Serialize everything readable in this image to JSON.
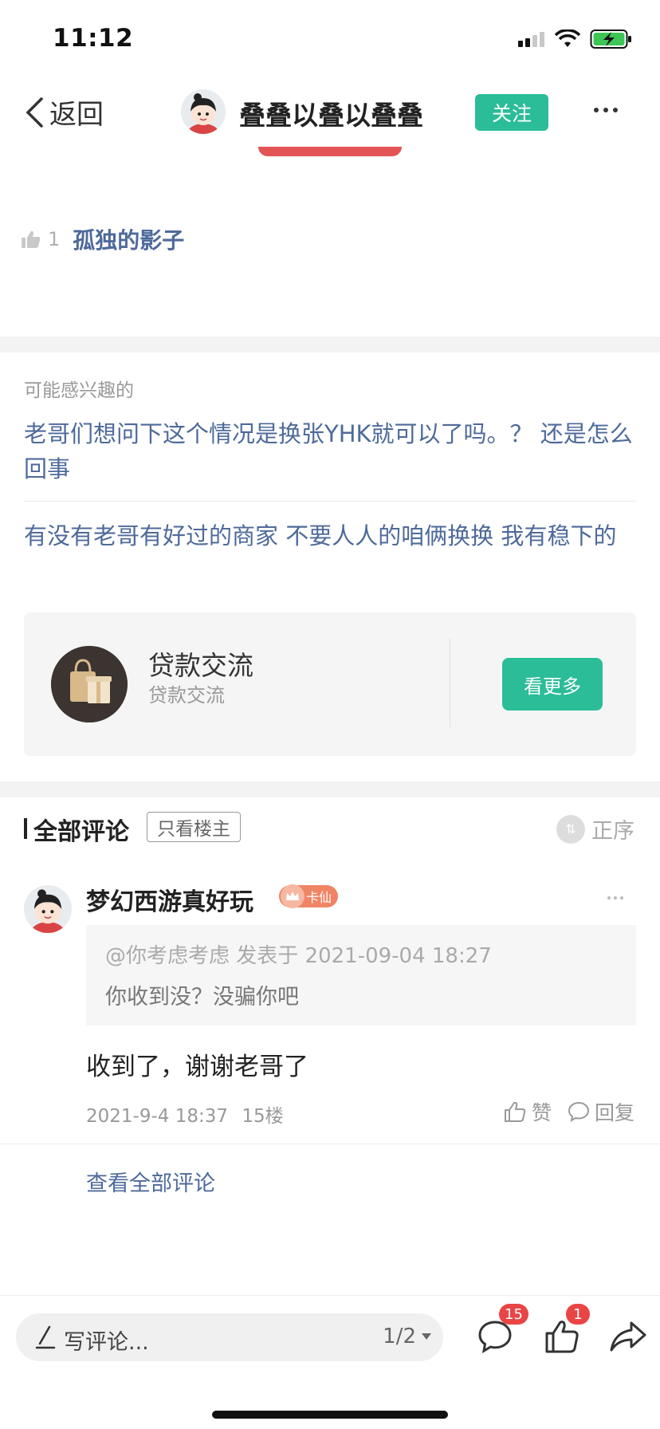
{
  "status": {
    "time": "11:12"
  },
  "nav": {
    "back_label": "返回",
    "title": "叠叠以叠以叠叠",
    "follow_label": "关注"
  },
  "likes": {
    "count": "1",
    "liker": "孤独的影子"
  },
  "interest": {
    "label": "可能感兴趣的",
    "items": [
      "老哥们想问下这个情况是换张YHK就可以了吗。？ 还是怎么回事",
      "有没有老哥有好过的商家 不要人人的咱俩换换 我有稳下的"
    ]
  },
  "forum": {
    "name": "贷款交流",
    "sub": "贷款交流",
    "more_label": "看更多"
  },
  "comments": {
    "title": "全部评论",
    "filter_label": "只看楼主",
    "order_label": "正序",
    "items": [
      {
        "user": "梦幻西游真好玩",
        "badge": "卡仙",
        "quote_head": "@你考虑考虑 发表于 2021-09-04 18:27",
        "quote_text": "你收到没？没骗你吧",
        "text": "收到了，谢谢老哥了",
        "time": "2021-9-4 18:37",
        "floor": "15楼",
        "like_label": "赞",
        "reply_label": "回复"
      }
    ],
    "view_all_label": "查看全部评论"
  },
  "bottom": {
    "write_placeholder": "写评论...",
    "page_indicator": "1/2",
    "comment_badge": "15",
    "like_badge": "1"
  },
  "colors": {
    "accent": "#2bbc98",
    "link": "#4e6a9a",
    "badge": "#e94545"
  }
}
